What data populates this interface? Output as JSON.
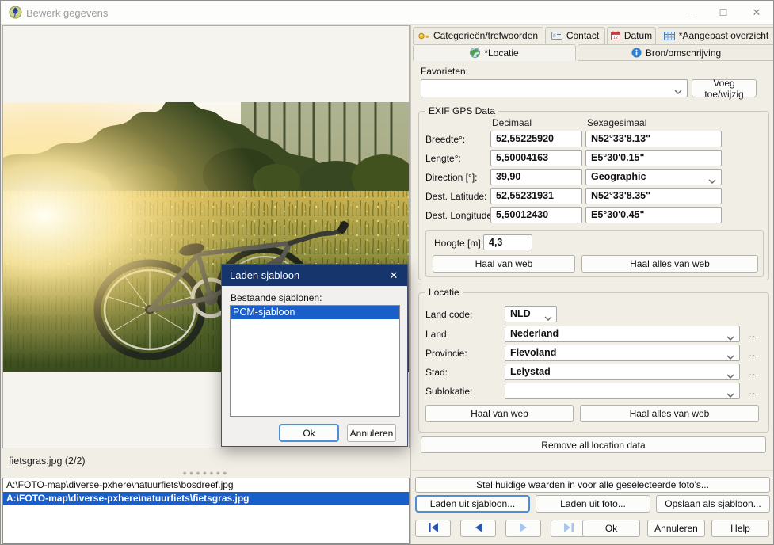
{
  "window": {
    "title": "Bewerk gegevens"
  },
  "tabs": {
    "row1": [
      {
        "label": "Categorieën/trefwoorden"
      },
      {
        "label": "Contact"
      },
      {
        "label": "Datum"
      },
      {
        "label": "*Aangepast overzicht"
      }
    ],
    "row2": [
      {
        "label": "*Locatie"
      },
      {
        "label": "Bron/omschrijving"
      }
    ]
  },
  "favorites": {
    "label": "Favorieten:",
    "value": "",
    "add_button": "Voeg toe/wijzig"
  },
  "gps": {
    "group_title": "EXIF GPS Data",
    "col_decimal": "Decimaal",
    "col_sexagesimal": "Sexagesimaal",
    "rows": [
      {
        "label": "Breedte°:",
        "decimal": "52,55225920",
        "sexagesimal": "N52°33'8.13\""
      },
      {
        "label": "Lengte°:",
        "decimal": "5,50004163",
        "sexagesimal": "E5°30'0.15\""
      },
      {
        "label": "Direction [°]:",
        "decimal": "39,90",
        "sexagesimal": "Geographic"
      },
      {
        "label": "Dest. Latitude:",
        "decimal": "52,55231931",
        "sexagesimal": "N52°33'8.35\""
      },
      {
        "label": "Dest. Longitude:",
        "decimal": "5,50012430",
        "sexagesimal": "E5°30'0.45\""
      }
    ],
    "height_label": "Hoogte [m]:",
    "height_value": "4,3",
    "fetch_web": "Haal van web",
    "fetch_all_web": "Haal alles van web"
  },
  "location": {
    "group_title": "Locatie",
    "more_label": "...",
    "fields": [
      {
        "label": "Land code:",
        "value": "NLD"
      },
      {
        "label": "Land:",
        "value": "Nederland"
      },
      {
        "label": "Provincie:",
        "value": "Flevoland"
      },
      {
        "label": "Stad:",
        "value": "Lelystad"
      },
      {
        "label": "Sublokatie:",
        "value": ""
      }
    ],
    "fetch_web": "Haal van web",
    "fetch_all_web": "Haal alles van web",
    "remove_button": "Remove all location data"
  },
  "actions": {
    "set_all": "Stel huidige waarden in voor alle geselecteerde foto's...",
    "load_template": "Laden uit sjabloon...",
    "load_photo": "Laden uit foto...",
    "save_template": "Opslaan als sjabloon...",
    "ok": "Ok",
    "cancel": "Annuleren",
    "help": "Help"
  },
  "viewer": {
    "status": "fietsgras.jpg (2/2)"
  },
  "files": [
    {
      "path": "A:\\FOTO-map\\diverse-pxhere\\natuurfiets\\bosdreef.jpg"
    },
    {
      "path": "A:\\FOTO-map\\diverse-pxhere\\natuurfiets\\fietsgras.jpg"
    }
  ],
  "modal": {
    "title": "Laden sjabloon",
    "label": "Bestaande sjablonen:",
    "items": [
      "PCM-sjabloon"
    ],
    "ok": "Ok",
    "cancel": "Annuleren"
  },
  "colors": {
    "selection_blue": "#1a5ec9",
    "modal_title_blue": "#17356d",
    "focus_ring_blue": "#4a90d8",
    "panel_cream": "#f1eee6"
  }
}
